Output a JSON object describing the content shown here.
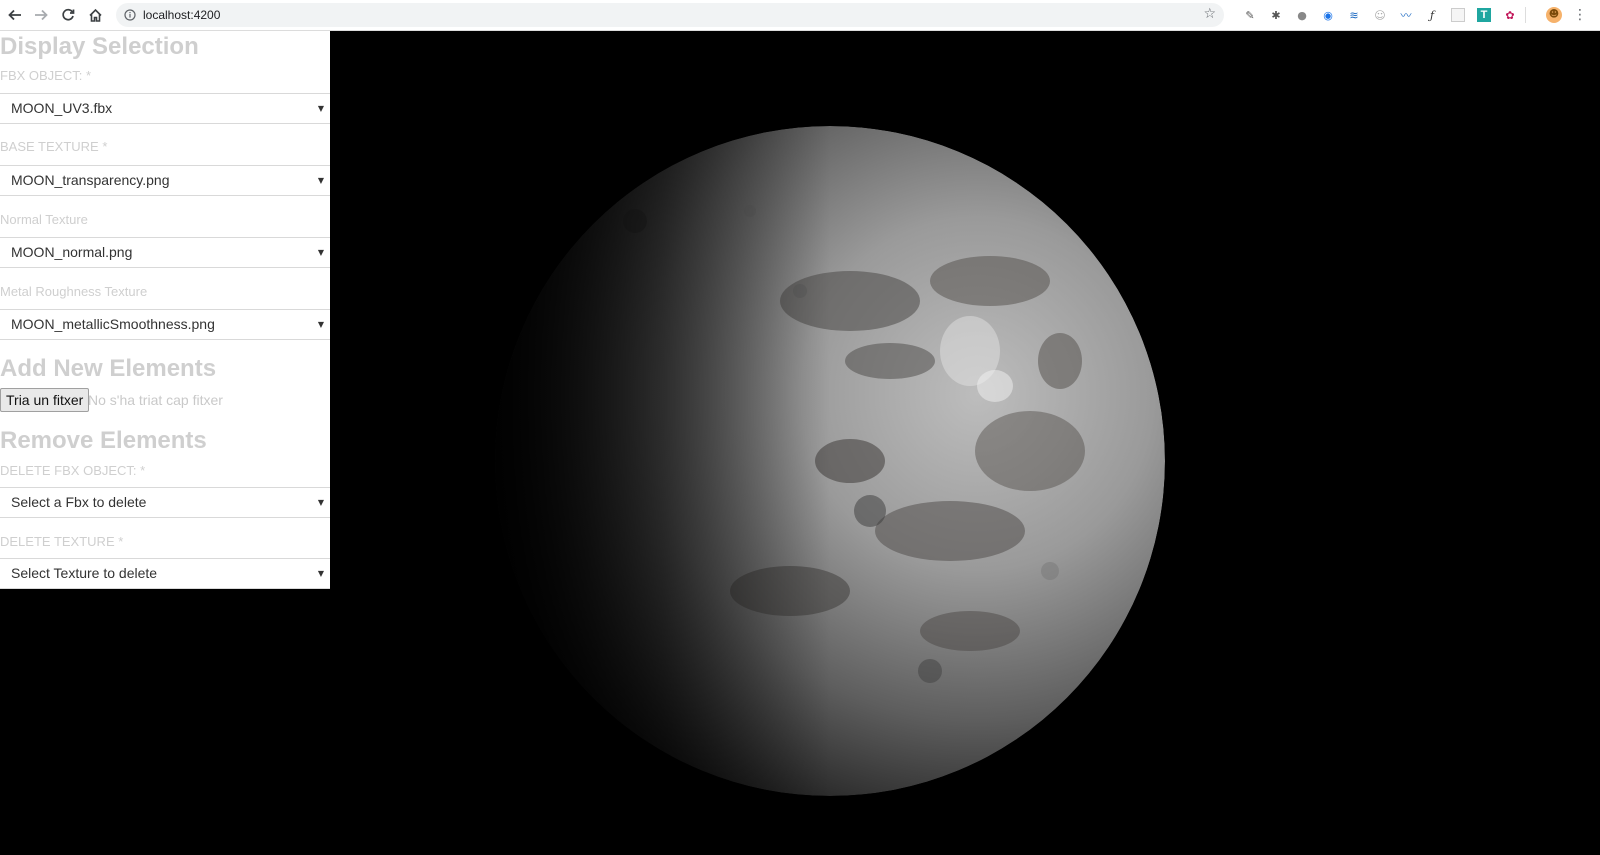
{
  "browser": {
    "url": "localhost:4200"
  },
  "panel": {
    "display_selection": {
      "title": "Display Selection",
      "fields": [
        {
          "label": "FBX OBJECT: *",
          "value": "MOON_UV3.fbx"
        },
        {
          "label": "BASE TEXTURE *",
          "value": "MOON_transparency.png"
        },
        {
          "label": "Normal Texture",
          "value": "MOON_normal.png"
        },
        {
          "label": "Metal Roughness Texture",
          "value": "MOON_metallicSmoothness.png"
        }
      ]
    },
    "add_new": {
      "title": "Add New Elements",
      "file_button": "Tria un fitxer",
      "file_status": "No s'ha triat cap fitxer"
    },
    "remove": {
      "title": "Remove Elements",
      "fields": [
        {
          "label": "DELETE FBX OBJECT: *",
          "value": "Select a Fbx to delete"
        },
        {
          "label": "DELETE TEXTURE *",
          "value": "Select Texture to delete"
        }
      ]
    }
  },
  "icons": {
    "back": "arrow-left-icon",
    "forward": "arrow-right-icon",
    "reload": "reload-icon",
    "home": "home-icon",
    "site_info": "info-icon",
    "bookmark": "star-icon",
    "menu": "kebab-menu-icon"
  },
  "colors": {
    "panel_text": "#cfcfcf",
    "viewport_bg": "#000000"
  }
}
